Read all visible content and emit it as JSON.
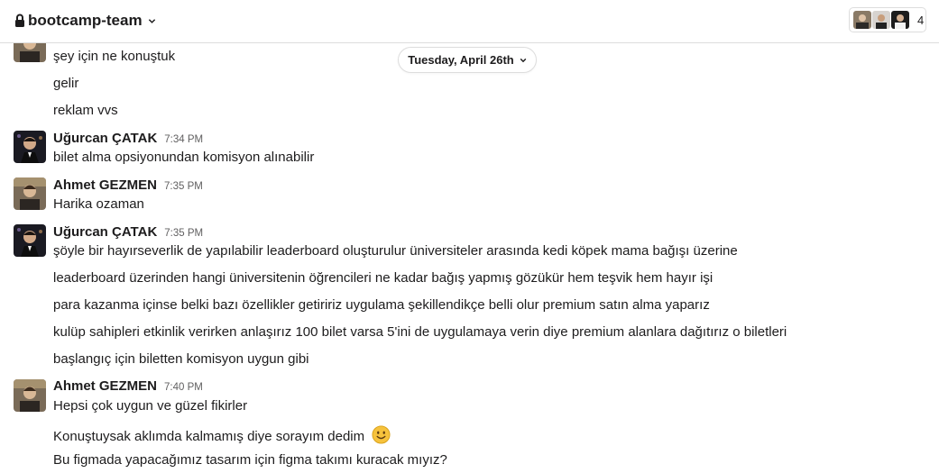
{
  "header": {
    "channel_name": "bootcamp-team",
    "member_count": "4"
  },
  "date_divider": {
    "label": "Tuesday, April 26th"
  },
  "colors": {
    "text": "#1d1c1d",
    "muted": "#616061",
    "border": "#dddddd",
    "emoji_face": "#f6c23c"
  },
  "messages": {
    "m0": {
      "lines": [
        "şey için ne konuştuk",
        "gelir",
        "reklam vvs"
      ]
    },
    "m1": {
      "sender": "Uğurcan ÇATAK",
      "time": "7:34 PM",
      "lines": [
        "bilet alma opsiyonundan komisyon alınabilir"
      ]
    },
    "m2": {
      "sender": "Ahmet GEZMEN",
      "time": "7:35 PM",
      "lines": [
        "Harika ozaman"
      ]
    },
    "m3": {
      "sender": "Uğurcan ÇATAK",
      "time": "7:35 PM",
      "lines": [
        "şöyle bir hayırseverlik de yapılabilir leaderboard oluşturulur üniversiteler arasında kedi köpek mama bağışı üzerine",
        "leaderboard üzerinden hangi üniversitenin öğrencileri ne kadar bağış yapmış gözükür hem teşvik hem hayır işi",
        "para kazanma içinse belki bazı özellikler getiririz uygulama şekillendikçe belli olur premium satın alma yaparız",
        "kulüp sahipleri etkinlik verirken anlaşırız 100 bilet varsa 5'ini de uygulamaya verin diye premium alanlara dağıtırız o biletleri",
        "başlangıç için biletten komisyon uygun gibi"
      ]
    },
    "m4": {
      "sender": "Ahmet GEZMEN",
      "time": "7:40 PM",
      "lines": [
        "Hepsi çok uygun ve güzel fikirler",
        "Konuştuysak aklımda kalmamış diye sorayım dedim",
        "Bu figmada yapacağımız tasarım için figma takımı kuracak mıyız?"
      ],
      "emoji": "slightly-smiling-face"
    }
  }
}
